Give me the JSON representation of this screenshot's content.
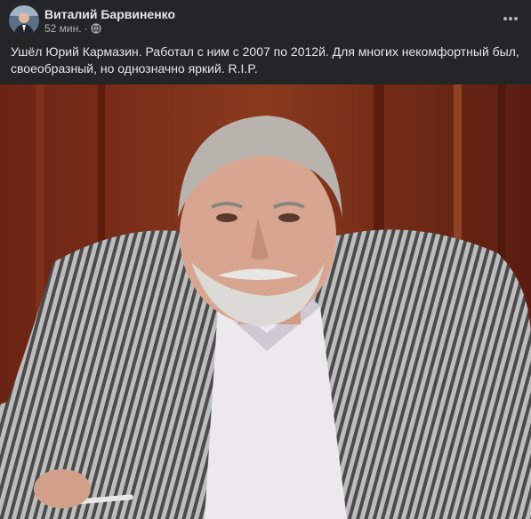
{
  "post": {
    "author": {
      "name": "Виталий Барвиненко",
      "avatar_icon": "user-avatar"
    },
    "timestamp": "52 мин.",
    "separator": "·",
    "privacy_icon": "globe-icon",
    "more_icon": "more-horizontal-icon",
    "text_line1": "Ушёл Юрий Кармазин. Работал с ним с 2007 по 2012й. Для многих некомфортный был,",
    "text_line2": "своеобразный, но однозначно яркий. R.I.P.",
    "photo_icon": "photo-portrait"
  },
  "colors": {
    "background": "#242526",
    "text_primary": "#e4e6eb",
    "text_secondary": "#b0b3b8",
    "photo_backdrop": "#7a2b16"
  }
}
